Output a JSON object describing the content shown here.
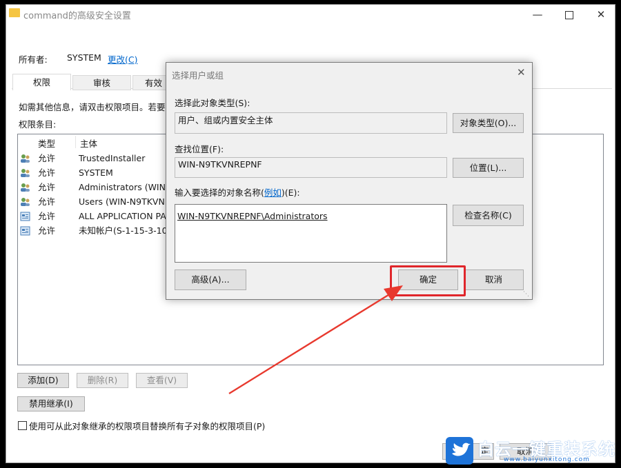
{
  "main_window": {
    "title": "command的高级安全设置",
    "owner_label": "所有者:",
    "owner_value": "SYSTEM",
    "change_link": "更改(C)",
    "tabs": [
      "权限",
      "审核",
      "有效"
    ],
    "info_text": "如需其他信息，请双击权限项目。若要",
    "entries_label": "权限条目:",
    "columns": [
      "类型",
      "主体"
    ],
    "entries": [
      {
        "type": "允许",
        "principal": "TrustedInstaller",
        "icon": "users-icon"
      },
      {
        "type": "允许",
        "principal": "SYSTEM",
        "icon": "users-icon"
      },
      {
        "type": "允许",
        "principal": "Administrators (WIN-",
        "icon": "users-icon"
      },
      {
        "type": "允许",
        "principal": "Users (WIN-N9TKVNI",
        "icon": "users-icon"
      },
      {
        "type": "允许",
        "principal": "ALL APPLICATION PAC",
        "icon": "package-icon"
      },
      {
        "type": "允许",
        "principal": "未知帐户(S-1-15-3-102",
        "icon": "package-icon"
      }
    ],
    "add_button": "添加(D)",
    "remove_button": "删除(R)",
    "view_button": "查看(V)",
    "disable_inherit_button": "禁用继承(I)",
    "replace_checkbox_label": "使用可从此对象继承的权限项目替换所有子对象的权限项目(P)",
    "bottom_btn_left_fragment": "定",
    "bottom_btn_right": "取消"
  },
  "dialog": {
    "title": "选择用户或组",
    "object_type_label": "选择此对象类型(S):",
    "object_type_value": "用户、组或内置安全主体",
    "object_type_button": "对象类型(O)...",
    "location_label": "查找位置(F):",
    "location_value": "WIN-N9TKVNREPNF",
    "location_button": "位置(L)...",
    "names_label_a": "输入要选择的对象名称(",
    "names_label_link": "例如",
    "names_label_b": ")(E):",
    "names_value": "WIN-N9TKVNREPNF\\Administrators",
    "check_names_button": "检查名称(C)",
    "advanced_button": "高级(A)...",
    "ok_button": "确定",
    "cancel_button": "取消"
  },
  "watermark": {
    "brand": "白云一键重装系统",
    "url": "www.baiyunxitong.com"
  },
  "colors": {
    "link": "#0066cc",
    "highlight_box": "#e0262b",
    "arrow": "#e8392e",
    "watermark_blue": "#1e73d8"
  }
}
